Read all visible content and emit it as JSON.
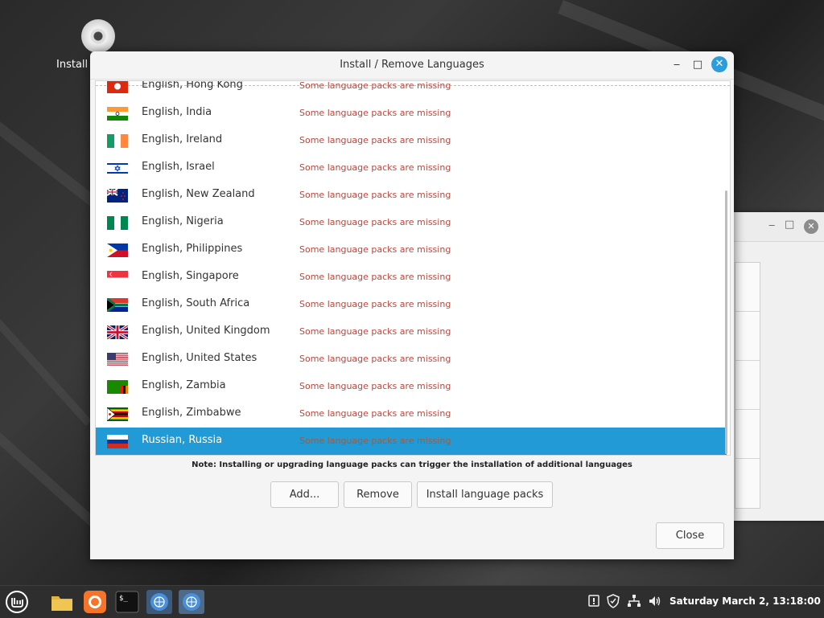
{
  "desktop": {
    "icon_label": "Install"
  },
  "dialog": {
    "title": "Install / Remove Languages",
    "minimize_glyph": "‒",
    "maximize_glyph": "□",
    "close_glyph": "✕",
    "note": "Note: Installing or upgrading language packs can trigger the installation of additional languages",
    "buttons": {
      "add": "Add...",
      "remove": "Remove",
      "install": "Install language packs",
      "close": "Close"
    }
  },
  "languages": [
    {
      "name": "English, Hong Kong",
      "status": "Some language packs are missing",
      "flag": "hk"
    },
    {
      "name": "English, India",
      "status": "Some language packs are missing",
      "flag": "in"
    },
    {
      "name": "English, Ireland",
      "status": "Some language packs are missing",
      "flag": "ie"
    },
    {
      "name": "English, Israel",
      "status": "Some language packs are missing",
      "flag": "il"
    },
    {
      "name": "English, New Zealand",
      "status": "Some language packs are missing",
      "flag": "nz"
    },
    {
      "name": "English, Nigeria",
      "status": "Some language packs are missing",
      "flag": "ng"
    },
    {
      "name": "English, Philippines",
      "status": "Some language packs are missing",
      "flag": "ph"
    },
    {
      "name": "English, Singapore",
      "status": "Some language packs are missing",
      "flag": "sg"
    },
    {
      "name": "English, South Africa",
      "status": "Some language packs are missing",
      "flag": "za"
    },
    {
      "name": "English, United Kingdom",
      "status": "Some language packs are missing",
      "flag": "gb"
    },
    {
      "name": "English, United States",
      "status": "Some language packs are missing",
      "flag": "us"
    },
    {
      "name": "English, Zambia",
      "status": "Some language packs are missing",
      "flag": "zm"
    },
    {
      "name": "English, Zimbabwe",
      "status": "Some language packs are missing",
      "flag": "zw"
    },
    {
      "name": "Russian, Russia",
      "status": "Some language packs are missing",
      "flag": "ru",
      "selected": true
    }
  ],
  "taskbar": {
    "clock": "Saturday March  2, 13:18:00",
    "apps": [
      "mint-menu-icon",
      "files-icon",
      "firefox-icon",
      "terminal-icon",
      "language-settings-icon",
      "language-settings-icon"
    ],
    "tray": [
      "notifications-icon",
      "update-shield-icon",
      "network-icon",
      "volume-icon"
    ]
  }
}
